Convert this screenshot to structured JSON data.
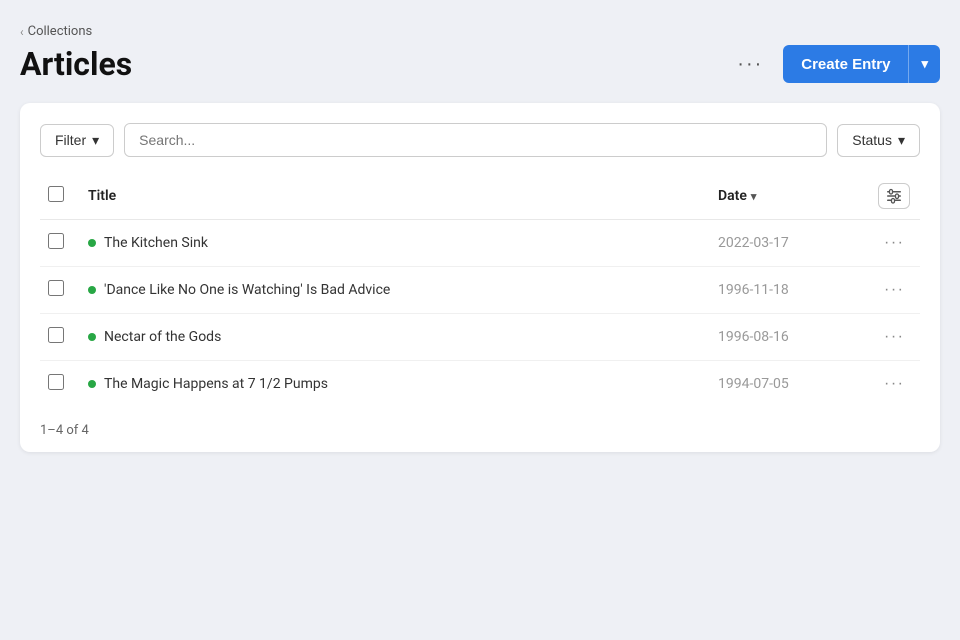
{
  "breadcrumb": {
    "chevron": "‹",
    "label": "Collections"
  },
  "page": {
    "title": "Articles"
  },
  "header": {
    "more_button_label": "···",
    "create_button_label": "Create Entry",
    "create_button_arrow": "▾"
  },
  "toolbar": {
    "filter_label": "Filter",
    "filter_arrow": "▾",
    "search_placeholder": "Search...",
    "status_label": "Status",
    "status_arrow": "▾"
  },
  "table": {
    "columns": {
      "title": "Title",
      "date": "Date",
      "date_sort": "▾"
    },
    "rows": [
      {
        "id": 1,
        "title": "The Kitchen Sink",
        "date": "2022-03-17",
        "status": "published"
      },
      {
        "id": 2,
        "title": "'Dance Like No One is Watching' Is Bad Advice",
        "date": "1996-11-18",
        "status": "published"
      },
      {
        "id": 3,
        "title": "Nectar of the Gods",
        "date": "1996-08-16",
        "status": "published"
      },
      {
        "id": 4,
        "title": "The Magic Happens at 7 1/2 Pumps",
        "date": "1994-07-05",
        "status": "published"
      }
    ]
  },
  "pagination": {
    "label": "1–4 of 4"
  },
  "colors": {
    "accent": "#2c7be5",
    "status_published": "#28a745"
  }
}
